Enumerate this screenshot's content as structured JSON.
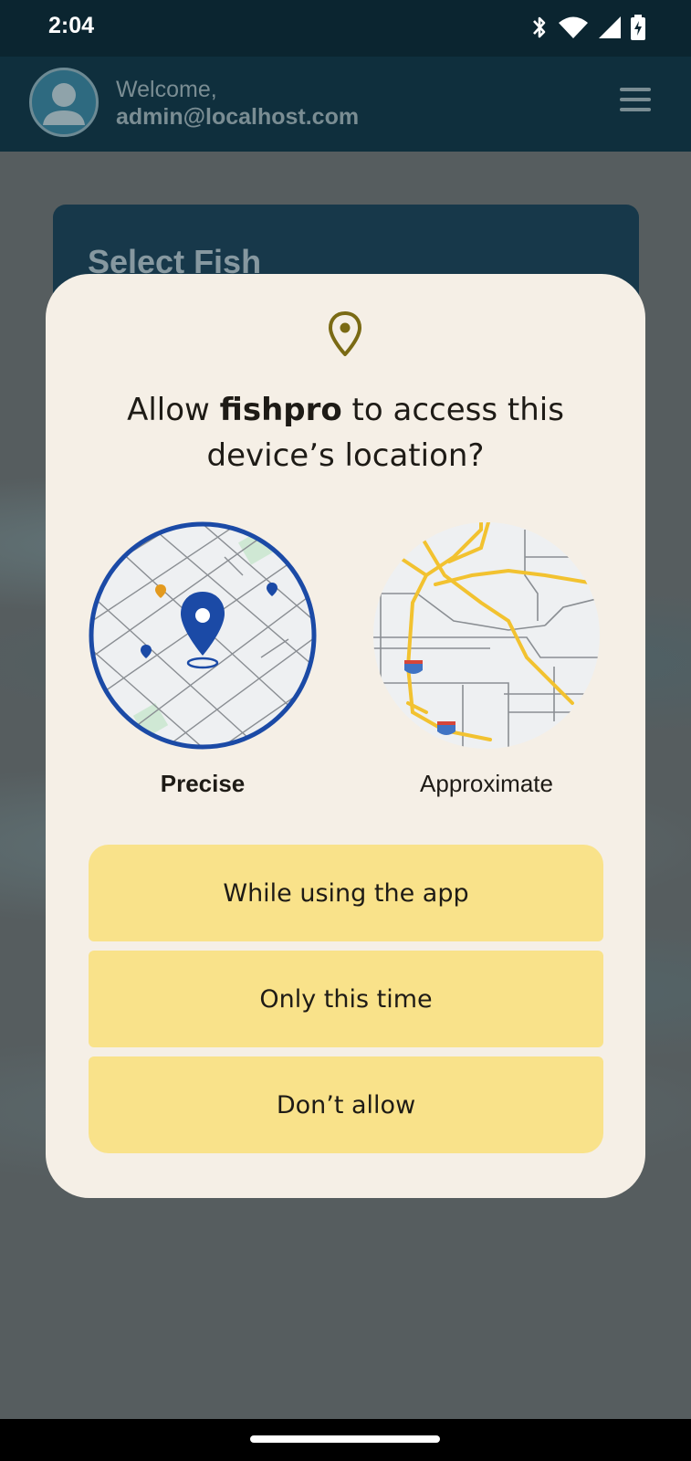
{
  "status_bar": {
    "time": "2:04",
    "icons": [
      "bluetooth-icon",
      "wifi-icon",
      "signal-icon",
      "battery-charging-icon"
    ]
  },
  "header": {
    "welcome": "Welcome,",
    "user": "admin@localhost.com"
  },
  "background_card": {
    "title": "Select Fish"
  },
  "dialog": {
    "title_prefix": "Allow ",
    "app_name": "fishpro",
    "title_suffix": " to access this device’s location?",
    "precise_label": "Precise",
    "approximate_label": "Approximate",
    "selected_accuracy": "Precise",
    "options": [
      "While using the app",
      "Only this time",
      "Don’t allow"
    ]
  },
  "colors": {
    "status_bar": "#0b2530",
    "header": "#0f2f3d",
    "dialog_bg": "#f5efe6",
    "button_bg": "#f9e28a",
    "pin_accent": "#7a6a14",
    "precise_blue": "#1b4aa6",
    "road_yellow": "#f2c230"
  }
}
